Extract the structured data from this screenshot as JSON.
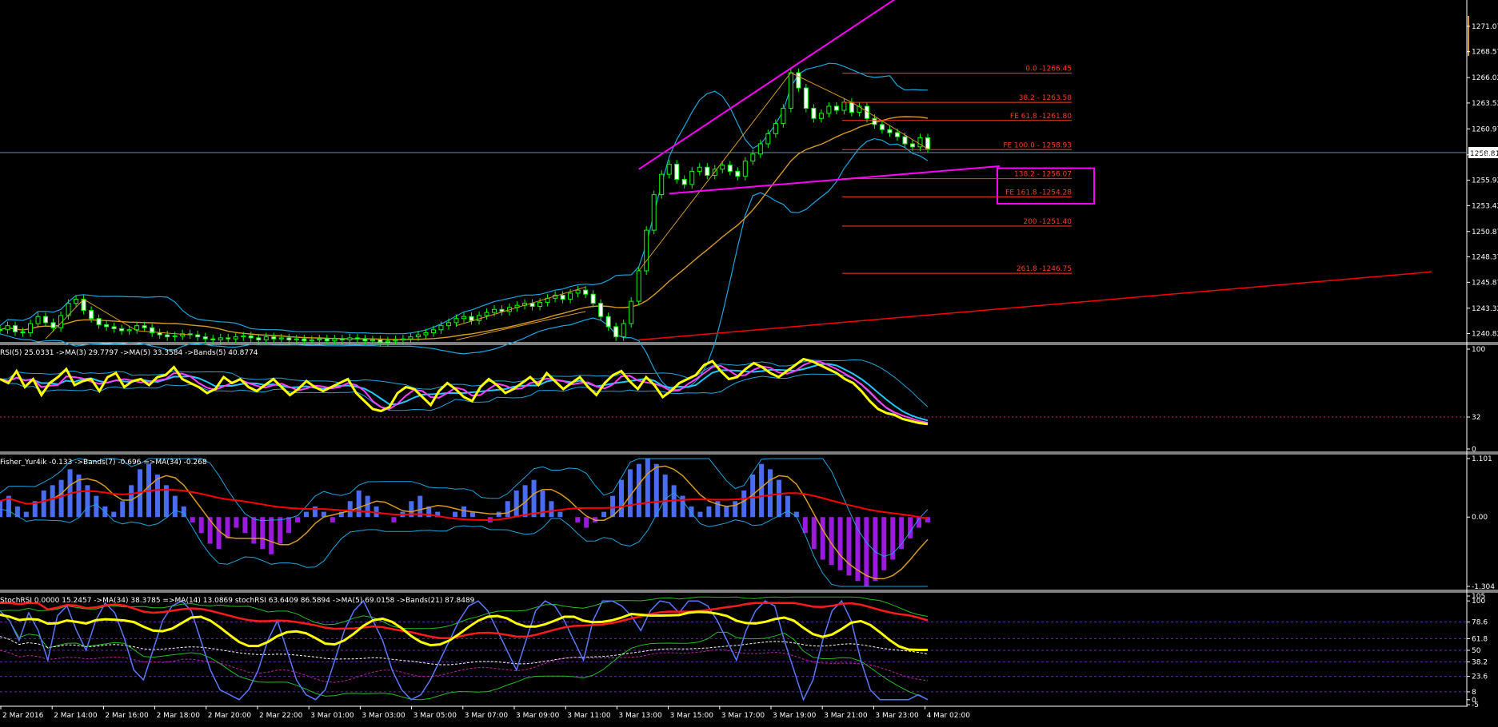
{
  "colors": {
    "background": "#000000",
    "axis": "#ffffff",
    "candle_up": "#00ff00",
    "bollinger": "#1aa6e0",
    "ma_orange": "#d89a20",
    "fibo": "#ff3a1a",
    "trendline_magenta": "#ff00ff",
    "trendline_red": "#ff0000",
    "rsi_yellow": "#ffff00",
    "rsi_magenta": "#ff40ff",
    "rsi_cyan": "#20c8ff",
    "histo_blue": "#4a6cf0",
    "histo_purple": "#9a1ae0",
    "stoch_blue": "#5a78ff",
    "stoch_green": "#20c020",
    "stoch_red": "#ff1a1a",
    "stoch_white": "#ffffff"
  },
  "price_panel": {
    "current_price": "1258.81",
    "price_min": 1240.0,
    "price_max": 1273.5,
    "ticks": [
      "1271.07",
      "1268.57",
      "1266.02",
      "1263.52",
      "1260.97",
      "1258.42",
      "1255.92",
      "1253.42",
      "1250.87",
      "1248.37",
      "1245.87",
      "1243.32",
      "1240.82"
    ],
    "fibo_levels": [
      {
        "label": "0.0 -1266.45",
        "price": 1266.45
      },
      {
        "label": "38.2 - 1263.58",
        "price": 1263.58
      },
      {
        "label": "FE 61.8 -1261.80",
        "price": 1261.8
      },
      {
        "label": "FE 100.0 - 1258.93",
        "price": 1258.93
      },
      {
        "label": "138.2 - 1256.07",
        "price": 1256.07
      },
      {
        "label": "FE 161.8 -1254.28",
        "price": 1254.28
      },
      {
        "label": "200 -1251.40",
        "price": 1251.4
      },
      {
        "label": "261.8 -1246.75",
        "price": 1246.75
      }
    ]
  },
  "rsi_panel": {
    "label": "RSI(5) 25.0331  ->MA(3) 29.7797  ->MA(5) 33.3584  ->Bands(5) 40.8774",
    "ticks": [
      "100",
      "32",
      "0"
    ],
    "min": 0,
    "max": 100
  },
  "fisher_panel": {
    "label": "Fisher_Yur4ik -0.133  ->Bands(7) -0.696  =>MA(34) -0.268",
    "ticks": [
      "1.101",
      "0.00",
      "-1.304"
    ],
    "min": -1.304,
    "max": 1.101
  },
  "stoch_panel": {
    "label": "StochRSI 0.0000 15.2457  ->MA(34) 38.3785  =>MA(14) 13.0869  stochRSI 63.6409 86.5894  ->MA(5) 69.0158  ->Bands(21) 87.8489",
    "ticks": [
      "105",
      "100",
      "78.6",
      "61.8",
      "50",
      "38.2",
      "23.6",
      "8",
      "0",
      "-5"
    ],
    "tick_values": [
      105,
      100,
      78.6,
      61.8,
      50,
      38.2,
      23.6,
      8,
      0,
      -5
    ],
    "min": -5,
    "max": 105
  },
  "time_axis": {
    "labels": [
      "2 Mar 2016",
      "2 Mar 14:00",
      "2 Mar 16:00",
      "2 Mar 18:00",
      "2 Mar 20:00",
      "2 Mar 22:00",
      "3 Mar 01:00",
      "3 Mar 03:00",
      "3 Mar 05:00",
      "3 Mar 07:00",
      "3 Mar 09:00",
      "3 Mar 11:00",
      "3 Mar 13:00",
      "3 Mar 15:00",
      "3 Mar 17:00",
      "3 Mar 19:00",
      "3 Mar 21:00",
      "3 Mar 23:00",
      "4 Mar 02:00"
    ]
  },
  "chart_data": {
    "type": "candlestick",
    "price_series": [
      1241.2,
      1241.6,
      1241.0,
      1240.9,
      1241.8,
      1242.5,
      1241.9,
      1241.4,
      1242.6,
      1243.8,
      1244.2,
      1243.1,
      1242.3,
      1241.7,
      1241.5,
      1241.3,
      1241.1,
      1241.2,
      1241.6,
      1241.4,
      1240.9,
      1240.7,
      1240.5,
      1240.6,
      1240.8,
      1240.7,
      1240.5,
      1240.3,
      1240.2,
      1240.4,
      1240.3,
      1240.5,
      1240.6,
      1240.4,
      1240.2,
      1240.5,
      1240.3,
      1240.4,
      1240.2,
      1240.3,
      1240.1,
      1240.2,
      1240.3,
      1240.1,
      1240.3,
      1240.2,
      1240.4,
      1240.3,
      1240.1,
      1240.2,
      1240.0,
      1240.1,
      1240.2,
      1240.3,
      1240.5,
      1240.7,
      1240.9,
      1241.2,
      1241.6,
      1241.9,
      1242.3,
      1242.5,
      1242.1,
      1242.6,
      1242.9,
      1243.2,
      1243.0,
      1243.4,
      1243.6,
      1243.8,
      1243.5,
      1243.9,
      1244.3,
      1244.6,
      1244.2,
      1244.8,
      1245.1,
      1244.7,
      1243.8,
      1242.5,
      1241.5,
      1240.5,
      1241.8,
      1244.0,
      1247.0,
      1251.0,
      1254.5,
      1256.5,
      1257.5,
      1256.0,
      1255.5,
      1256.8,
      1257.2,
      1256.4,
      1257.0,
      1257.4,
      1256.8,
      1256.3,
      1257.8,
      1258.5,
      1259.5,
      1260.5,
      1261.5,
      1263.0,
      1266.5,
      1265.0,
      1263.0,
      1262.0,
      1262.5,
      1263.2,
      1262.8,
      1263.6,
      1262.6,
      1263.2,
      1262.0,
      1261.4,
      1260.9,
      1260.6,
      1260.2,
      1259.5,
      1259.2,
      1260.1,
      1259.0
    ],
    "rsi_series": [
      70,
      66,
      78,
      62,
      70,
      54,
      66,
      72,
      80,
      64,
      68,
      70,
      58,
      72,
      76,
      62,
      68,
      70,
      64,
      72,
      74,
      82,
      70,
      66,
      62,
      56,
      60,
      72,
      66,
      70,
      62,
      58,
      64,
      70,
      62,
      54,
      60,
      68,
      62,
      58,
      62,
      66,
      70,
      56,
      48,
      40,
      38,
      42,
      56,
      62,
      60,
      52,
      44,
      58,
      66,
      60,
      52,
      48,
      62,
      70,
      64,
      56,
      60,
      66,
      72,
      64,
      76,
      68,
      60,
      66,
      72,
      62,
      54,
      66,
      74,
      78,
      68,
      60,
      72,
      64,
      52,
      58,
      66,
      70,
      74,
      84,
      88,
      78,
      70,
      72,
      80,
      86,
      82,
      76,
      72,
      78,
      84,
      90,
      88,
      84,
      80,
      76,
      70,
      66,
      58,
      48,
      40,
      36,
      34,
      30,
      28,
      26,
      25
    ],
    "fisher_series": [
      0.3,
      0.4,
      0.2,
      0.1,
      0.3,
      0.5,
      0.6,
      0.7,
      0.9,
      0.8,
      0.6,
      0.4,
      0.2,
      0.1,
      0.3,
      0.6,
      0.9,
      1.0,
      0.8,
      0.6,
      0.4,
      0.2,
      -0.1,
      -0.3,
      -0.5,
      -0.6,
      -0.4,
      -0.2,
      -0.3,
      -0.5,
      -0.6,
      -0.7,
      -0.5,
      -0.3,
      -0.1,
      0.1,
      0.2,
      0.1,
      -0.1,
      0.1,
      0.3,
      0.5,
      0.4,
      0.2,
      0.0,
      -0.1,
      0.1,
      0.3,
      0.4,
      0.2,
      0.1,
      0.0,
      0.1,
      0.2,
      0.1,
      0.0,
      -0.1,
      0.1,
      0.3,
      0.5,
      0.6,
      0.7,
      0.5,
      0.3,
      0.1,
      0.0,
      -0.1,
      -0.2,
      -0.1,
      0.1,
      0.4,
      0.7,
      0.9,
      1.0,
      1.1,
      1.0,
      0.8,
      0.6,
      0.4,
      0.2,
      0.1,
      0.2,
      0.3,
      0.2,
      0.3,
      0.5,
      0.8,
      1.0,
      0.9,
      0.7,
      0.4,
      0.1,
      -0.3,
      -0.6,
      -0.8,
      -0.9,
      -1.0,
      -1.1,
      -1.2,
      -1.3,
      -1.2,
      -1.0,
      -0.8,
      -0.6,
      -0.4,
      -0.2,
      -0.1
    ],
    "stoch_series": [
      90,
      80,
      60,
      88,
      70,
      40,
      85,
      95,
      70,
      50,
      80,
      98,
      88,
      62,
      30,
      20,
      50,
      80,
      95,
      100,
      90,
      60,
      30,
      10,
      5,
      0,
      10,
      30,
      60,
      80,
      50,
      20,
      5,
      0,
      10,
      40,
      70,
      90,
      100,
      80,
      60,
      30,
      10,
      0,
      5,
      20,
      40,
      60,
      80,
      95,
      100,
      90,
      70,
      50,
      30,
      60,
      90,
      100,
      95,
      80,
      60,
      40,
      80,
      100,
      100,
      95,
      85,
      70,
      90,
      100,
      98,
      88,
      100,
      100,
      95,
      80,
      60,
      40,
      70,
      90,
      100,
      95,
      60,
      30,
      0,
      20,
      60,
      90,
      100,
      80,
      40,
      10,
      0,
      0,
      0,
      0,
      5,
      0
    ]
  }
}
